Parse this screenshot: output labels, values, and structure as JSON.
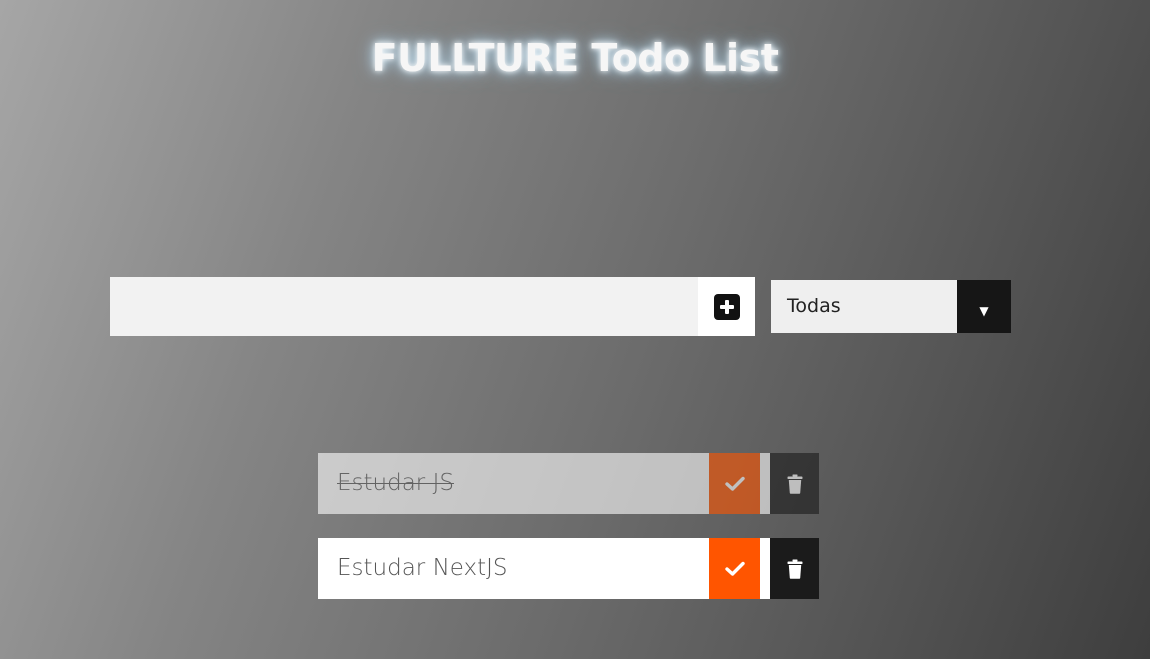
{
  "header": {
    "title": "FULLTURE Todo List"
  },
  "form": {
    "input_value": "",
    "input_placeholder": "",
    "add_icon": "plus-square-icon"
  },
  "filter": {
    "selected": "Todas",
    "arrow": "▼"
  },
  "todos": [
    {
      "text": "Estudar JS",
      "completed": true
    },
    {
      "text": "Estudar NextJS",
      "completed": false
    }
  ],
  "colors": {
    "complete_button": "#ff5500",
    "trash_button": "#1b1b1b",
    "filter_arrow_bg": "#161616"
  }
}
